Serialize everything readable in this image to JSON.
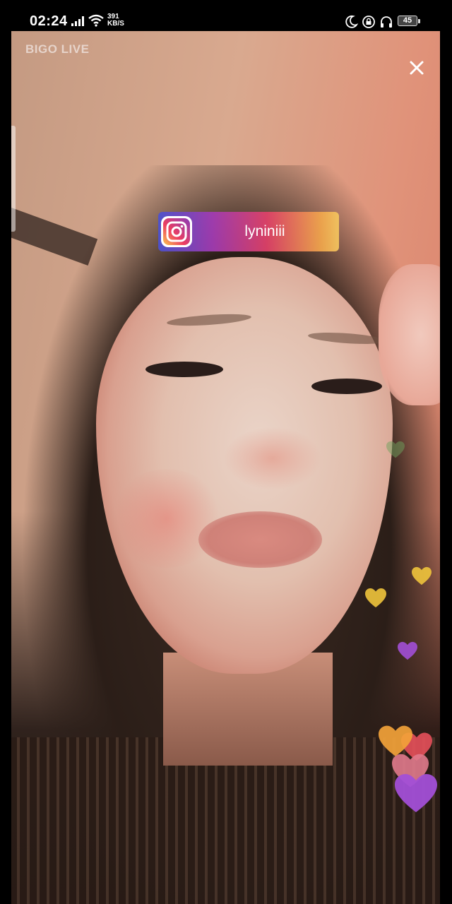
{
  "status_bar": {
    "time": "02:24",
    "net_speed_value": "391",
    "net_speed_unit": "KB/S",
    "battery": "45"
  },
  "stream": {
    "brand": "BIGO LIVE",
    "instagram_username": "lyniniii"
  },
  "icons": {
    "signal": "signal-icon",
    "wifi": "wifi-icon",
    "moon": "moon-icon",
    "lock_rotate": "lock-rotate-icon",
    "headphones": "headphones-icon",
    "close": "close-icon",
    "instagram": "instagram-icon",
    "heart": "heart-icon"
  },
  "colors": {
    "heart_yellow": "#f0c43c",
    "heart_orange": "#f2a23a",
    "heart_red": "#e5505a",
    "heart_purple": "#a24fd6",
    "heart_pink": "#e07a8c",
    "heart_green": "#6fa25e"
  }
}
